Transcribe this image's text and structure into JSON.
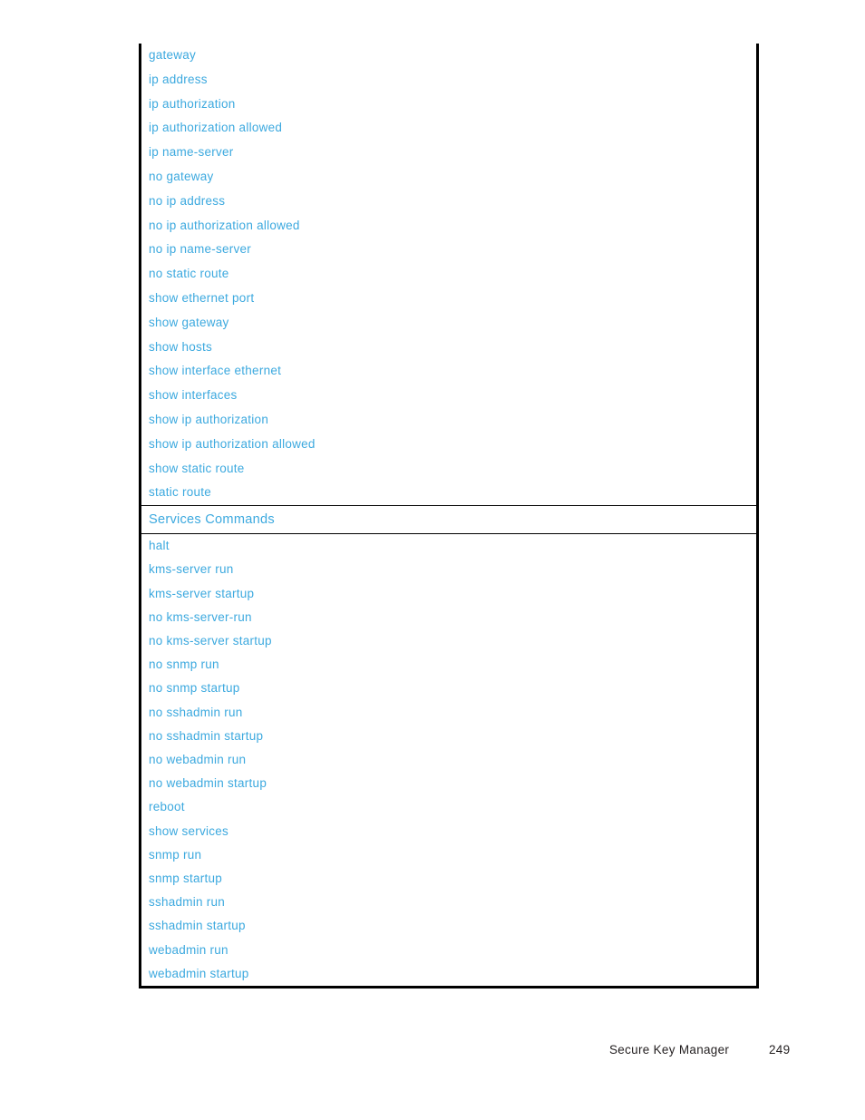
{
  "page": {
    "footer": {
      "title": "Secure Key Manager",
      "page_number": "249"
    }
  },
  "table": {
    "text_color": "#3CA9DF",
    "border_color": "#000000",
    "groups": [
      {
        "kind": "commands",
        "rows": [
          {
            "label": "gateway"
          },
          {
            "label": "ip address"
          },
          {
            "label": "ip authorization"
          },
          {
            "label": "ip authorization allowed"
          },
          {
            "label": "ip name-server"
          },
          {
            "label": "no gateway"
          },
          {
            "label": "no ip address"
          },
          {
            "label": "no ip authorization allowed"
          },
          {
            "label": "no ip name-server"
          },
          {
            "label": "no static route"
          },
          {
            "label": "show ethernet port"
          },
          {
            "label": "show gateway"
          },
          {
            "label": "show hosts"
          },
          {
            "label": "show interface ethernet"
          },
          {
            "label": "show interfaces"
          },
          {
            "label": "show ip authorization"
          },
          {
            "label": "show ip authorization allowed"
          },
          {
            "label": "show static route"
          },
          {
            "label": "static route"
          }
        ]
      },
      {
        "kind": "section-header",
        "label": "Services Commands"
      },
      {
        "kind": "commands",
        "rows": [
          {
            "label": "halt"
          },
          {
            "label": "kms-server run"
          },
          {
            "label": "kms-server startup"
          },
          {
            "label": "no kms-server-run"
          },
          {
            "label": "no kms-server startup"
          },
          {
            "label": "no snmp run"
          },
          {
            "label": "no snmp startup"
          },
          {
            "label": "no sshadmin run"
          },
          {
            "label": "no sshadmin startup"
          },
          {
            "label": "no webadmin run"
          },
          {
            "label": "no webadmin startup"
          },
          {
            "label": "reboot"
          },
          {
            "label": "show services"
          },
          {
            "label": "snmp run"
          },
          {
            "label": "snmp startup"
          },
          {
            "label": "sshadmin run"
          },
          {
            "label": "sshadmin startup"
          },
          {
            "label": "webadmin run"
          },
          {
            "label": "webadmin startup"
          }
        ]
      }
    ]
  }
}
